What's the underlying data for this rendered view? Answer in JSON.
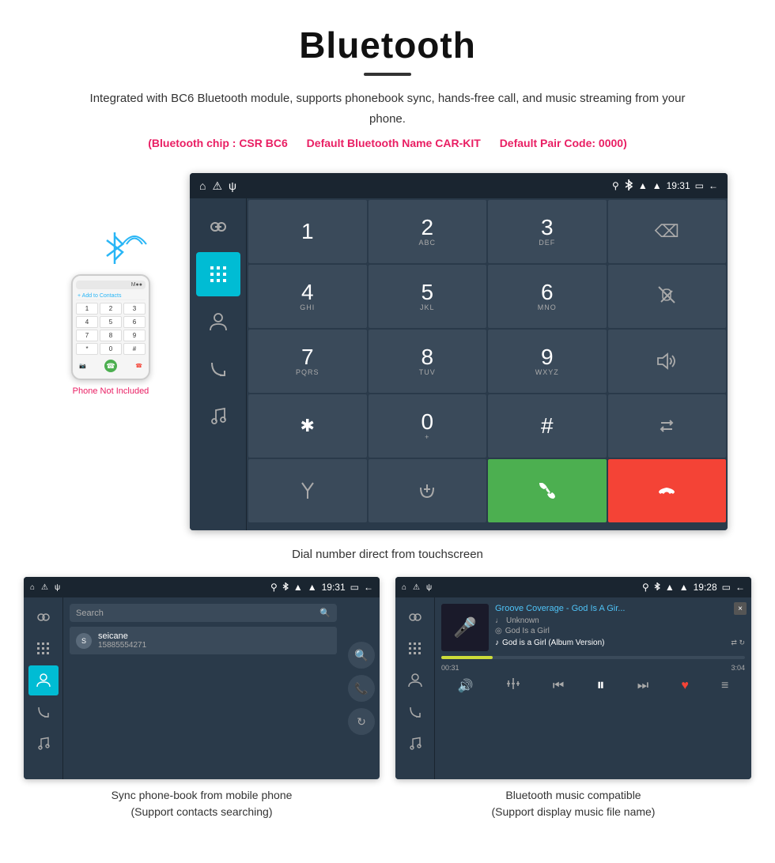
{
  "header": {
    "title": "Bluetooth",
    "description": "Integrated with BC6 Bluetooth module, supports phonebook sync, hands-free call, and music streaming from your phone.",
    "specs": {
      "chip_label": "(Bluetooth chip : CSR BC6",
      "name_label": "Default Bluetooth Name CAR-KIT",
      "pair_label": "Default Pair Code: 0000)"
    }
  },
  "phone_mockup": {
    "not_included": "Phone Not Included",
    "add_contact": "+ Add to Contacts",
    "keys": [
      "1",
      "2",
      "3",
      "4",
      "5",
      "6",
      "7",
      "8",
      "9",
      "*",
      "0",
      "#"
    ]
  },
  "car_ui": {
    "status_time": "19:31",
    "sidebar_icons": [
      "link",
      "dialpad",
      "person",
      "call_forward",
      "music_note"
    ],
    "dialpad": {
      "keys": [
        {
          "main": "1",
          "sub": ""
        },
        {
          "main": "2",
          "sub": "ABC"
        },
        {
          "main": "3",
          "sub": "DEF"
        },
        {
          "main": "⌫",
          "sub": "",
          "type": "backspace"
        },
        {
          "main": "4",
          "sub": "GHI"
        },
        {
          "main": "5",
          "sub": "JKL"
        },
        {
          "main": "6",
          "sub": "MNO"
        },
        {
          "main": "🎤",
          "sub": "",
          "type": "mute"
        },
        {
          "main": "7",
          "sub": "PQRS"
        },
        {
          "main": "8",
          "sub": "TUV"
        },
        {
          "main": "9",
          "sub": "WXYZ"
        },
        {
          "main": "🔊",
          "sub": "",
          "type": "volume"
        },
        {
          "main": "✱",
          "sub": ""
        },
        {
          "main": "0",
          "sub": "+"
        },
        {
          "main": "#",
          "sub": ""
        },
        {
          "main": "⇅",
          "sub": "",
          "type": "swap"
        },
        {
          "main": "⊹",
          "sub": "",
          "type": "merge"
        },
        {
          "main": "⇄",
          "sub": "",
          "type": "hold"
        },
        {
          "main": "📞",
          "sub": "",
          "type": "call-green"
        },
        {
          "main": "📵",
          "sub": "",
          "type": "call-red"
        }
      ]
    }
  },
  "bottom_left": {
    "status_time": "19:31",
    "search_placeholder": "Search",
    "contact": {
      "avatar": "S",
      "name": "seicane",
      "number": "15885554271"
    },
    "caption_line1": "Sync phone-book from mobile phone",
    "caption_line2": "(Support contacts searching)"
  },
  "bottom_right": {
    "status_time": "19:28",
    "music_title": "Groove Coverage - God Is A Gir...",
    "music_artist": "Unknown",
    "music_album": "God Is a Girl",
    "music_track": "God is a Girl (Album Version)",
    "progress_current": "00:31",
    "progress_total": "3:04",
    "progress_pct": 17,
    "caption_line1": "Bluetooth music compatible",
    "caption_line2": "(Support display music file name)"
  },
  "captions": {
    "dialpad": "Dial number direct from touchscreen"
  }
}
